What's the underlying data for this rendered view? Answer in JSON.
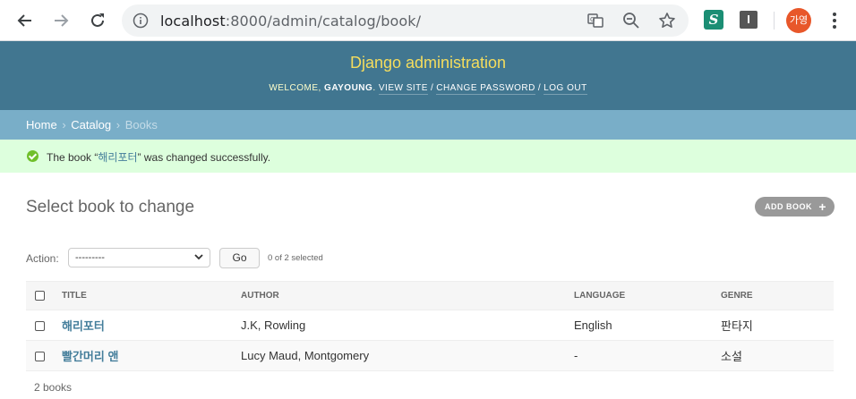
{
  "browser": {
    "url_host": "localhost",
    "url_path": ":8000/admin/catalog/book/",
    "profile_initials": "가영"
  },
  "header": {
    "site_name": "Django administration",
    "welcome": "Welcome,",
    "username": "gayoung",
    "view_site": "View site",
    "change_password": "Change password",
    "log_out": "Log out",
    "separator": "/"
  },
  "breadcrumbs": {
    "home": "Home",
    "catalog": "Catalog",
    "current": "Books",
    "separator": "›"
  },
  "message": {
    "prefix": "The book “",
    "object": "해리포터",
    "suffix": "” was changed successfully."
  },
  "content": {
    "title": "Select book to change",
    "add_button": "Add book"
  },
  "actions": {
    "label": "Action:",
    "selected_option": "---------",
    "go_label": "Go",
    "counter": "0 of 2 selected"
  },
  "table": {
    "columns": [
      "Title",
      "Author",
      "Language",
      "Genre"
    ],
    "rows": [
      {
        "title": "해리포터",
        "author": "J.K, Rowling",
        "language": "English",
        "genre": "판타지"
      },
      {
        "title": "빨간머리 앤",
        "author": "Lucy Maud, Montgomery",
        "language": "-",
        "genre": "소설"
      }
    ]
  },
  "paginator": "2 books",
  "colors": {
    "header_bg": "#417690",
    "brand": "#f5dd5d",
    "breadcrumbs_bg": "#79aec8",
    "success_bg": "#ddffdd",
    "link": "#447e9b"
  }
}
